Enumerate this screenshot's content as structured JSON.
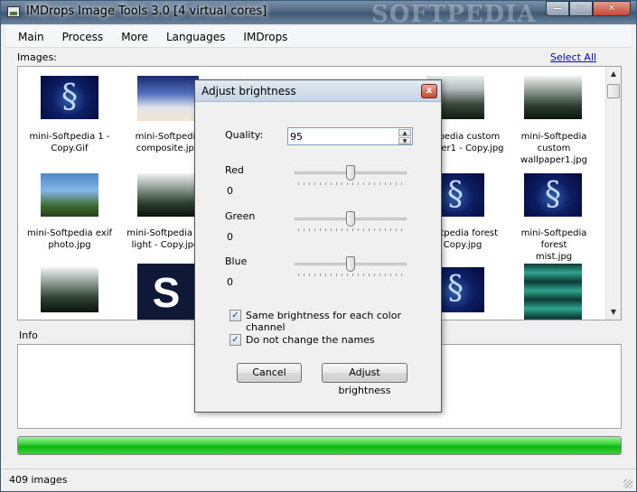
{
  "window": {
    "title": "IMDrops Image Tools 3.0 [4 virtual cores]",
    "watermark": "SOFTPEDIA",
    "min_glyph": "—",
    "max_glyph": "□",
    "close_glyph": "✕"
  },
  "menu": [
    "Main",
    "Process",
    "More",
    "Languages",
    "IMDrops"
  ],
  "images_label": "Images:",
  "select_all": "Select All",
  "tiles": [
    {
      "caption1": "mini-Softpedia 1 -",
      "caption2": "Copy.Gif"
    },
    {
      "caption1": "mini-Softpedia",
      "caption2": "composite.jpg"
    },
    {
      "caption1": "fpedia custom",
      "caption2": "per1 - Copy.jpg"
    },
    {
      "caption1": "mini-Softpedia custom",
      "caption2": "wallpaper1.jpg"
    },
    {
      "caption1": "mini-Softpedia exif",
      "caption2": "photo.jpg"
    },
    {
      "caption1": "mini-Softpedia fo",
      "caption2": "light - Copy.jpg"
    },
    {
      "caption1": "ftpedia forest",
      "caption2": "- Copy.jpg"
    },
    {
      "caption1": "mini-Softpedia forest",
      "caption2": "mist.jpg"
    }
  ],
  "info_label": "Info",
  "progress_fraction": 1.0,
  "status": "409 images",
  "dialog": {
    "title": "Adjust brightness",
    "close_glyph": "x",
    "quality_label": "Quality:",
    "quality_value": "95",
    "red_label": "Red",
    "red_value": "0",
    "green_label": "Green",
    "green_value": "0",
    "blue_label": "Blue",
    "blue_value": "0",
    "same_brightness_label": "Same brightness for each color channel",
    "no_rename_label": "Do not change the names",
    "check_glyph": "✓",
    "cancel_label": "Cancel",
    "apply_label": "Adjust brightness"
  },
  "colors": {
    "progress_green": "#12b812",
    "link_blue": "#0000e0"
  }
}
